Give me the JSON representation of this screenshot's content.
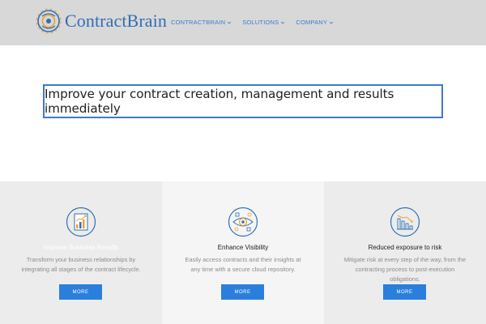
{
  "brand": {
    "name": "ContractBrain",
    "color": "#2f6fb5",
    "logo_icon": "brain-gear-logo-icon"
  },
  "nav": {
    "items": [
      {
        "label": "CONTRACTBRAIN"
      },
      {
        "label": "SOLUTIONS"
      },
      {
        "label": "COMPANY"
      }
    ],
    "color": "#3a7bd5"
  },
  "hero": {
    "text": "Improve your contract creation, management and results immediately",
    "border_color": "#3d7ac9"
  },
  "features": [
    {
      "icon": "growth-chart-icon",
      "title": "Improve Business Results",
      "description": "Transform your business relationships by integrating all stages of the contract lifecycle.",
      "button": "MORE"
    },
    {
      "icon": "visibility-eye-icon",
      "title": "Enhance Visibility",
      "description": "Easily access contracts and their insights at any time with a secure cloud repository.",
      "button": "MORE"
    },
    {
      "icon": "risk-chart-icon",
      "title": "Reduced exposure to risk",
      "description": "Mitigate risk at every step of the way, from the contracting process to post-execution obligations.",
      "button": "MORE"
    }
  ],
  "colors": {
    "header_bg": "#d8d8d8",
    "button_bg": "#2a7fdc",
    "icon_stroke": "#2f6fb5",
    "accent_orange": "#f0a030"
  }
}
